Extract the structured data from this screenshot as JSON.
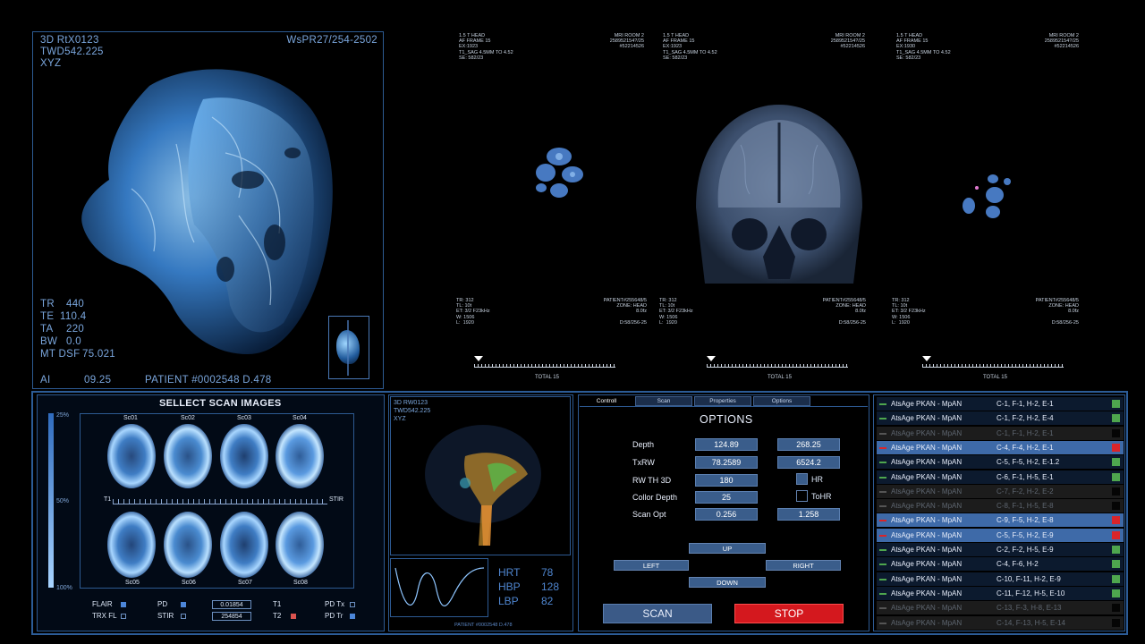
{
  "head_panel": {
    "id_line1": "3D RtX0123",
    "id_line2": "TWD542.225",
    "id_line3": "XYZ",
    "ref": "WsPR27/254-2502",
    "stats": [
      {
        "label": "TR",
        "value": "440"
      },
      {
        "label": "TE",
        "value": "110.4"
      },
      {
        "label": "TA",
        "value": "220"
      },
      {
        "label": "BW",
        "value": "0.0"
      },
      {
        "label": "MT DSF",
        "value": "75.021"
      }
    ],
    "ai_label": "AI",
    "ai_value": "09.25",
    "patient": "PATIENT #0002548 D.478"
  },
  "slices": [
    {
      "tl": "1.5 T HEAD\nAF FRAME 15\nEX:1923\nT1_SAG 4.5MM TO 4.52\nSE: 582/23",
      "tr": "MRI ROOM 2\n258952154?/25\n#52214526",
      "bl": "TR: 312\nTL: 10t\nET: 3/2 F23kHz\nW: 1506\nL:  1920",
      "br": "PATIENT#255648/5\nZONE: HEAD\n8.0fz\n\nD:58/256-25",
      "total": "TOTAL 15"
    },
    {
      "tl": "1.5 T HEAD\nAF FRAME 15\nEX:1923\nT1_SAG 4.5MM TO 4.52\nSE: 582/23",
      "tr": "MRI ROOM 2\n258952154?/25\n#52214526",
      "bl": "TR: 312\nTL: 10t\nET: 3/2 F23kHz\nW: 1506\nL:  1920",
      "br": "PATIENT#255648/5\nZONE: HEAD\n8.0fz\n\nD:58/256-25",
      "total": "TOTAL 15"
    },
    {
      "tl": "1.5 T HEAD\nAF FRAME 15\nEX:1930\nT1_SAG 4.5MM TO 4.52\nSE: 582/23",
      "tr": "MRI ROOM 2\n258952154?/25\n#52214526",
      "bl": "TR: 312\nTL: 10t\nET: 3/2 F23kHz\nW: 1506\nL:  1920",
      "br": "PATIENT#255648/5\nZONE: HEAD\n8.0fz\n\nD:58/256-25",
      "total": "TOTAL 15"
    }
  ],
  "scan_select": {
    "title": "SELLECT SCAN IMAGES",
    "scale_top": "25%",
    "scale_mid": "50%",
    "scale_bottom": "100%",
    "top_labels": [
      "Sc01",
      "Sc02",
      "Sc03",
      "Sc04"
    ],
    "bottom_labels": [
      "Sc05",
      "Sc06",
      "Sc07",
      "Sc08"
    ],
    "axis_left": "T1",
    "axis_right": "STIR",
    "legend": {
      "flair": "FLAIR",
      "trx": "TRX FL",
      "pd": "PD",
      "stir": "STIR",
      "val1": "0.01854",
      "val2": "254854",
      "t1": "T1",
      "t2": "T2",
      "pdtx": "PD Tx",
      "pdtr": "PD Tr"
    }
  },
  "mini3d": {
    "line1": "3D RW0123",
    "line2": "TWD542.225",
    "line3": "XYZ",
    "vitals": [
      {
        "label": "HRT",
        "value": "78"
      },
      {
        "label": "HBP",
        "value": "128"
      },
      {
        "label": "LBP",
        "value": "82"
      }
    ],
    "patient": "PATIENT #0002548 D.478"
  },
  "options": {
    "tabs": [
      "Controll",
      "Scan",
      "Properties",
      "Options"
    ],
    "title": "OPTIONS",
    "rows": [
      {
        "label": "Depth",
        "v1": "124.89",
        "v2": "268.25"
      },
      {
        "label": "TxRW",
        "v1": "78.2589",
        "v2": "6524.2"
      },
      {
        "label": "RW TH 3D",
        "v1": "180"
      },
      {
        "label": "Collor Depth",
        "v1": "25"
      },
      {
        "label": "Scan Opt",
        "v1": "0.256",
        "v2": "1.258"
      }
    ],
    "hr": "HR",
    "tohr": "ToHR",
    "up": "UP",
    "left": "LEFT",
    "right": "RIGHT",
    "down": "DOWN",
    "scan": "SCAN",
    "stop": "STOP"
  },
  "list": [
    {
      "name": "AtsAge PKAN - MpAN",
      "code": "C-1, F-1, H-2, E-1",
      "state": "ok",
      "dim": false,
      "hl": false
    },
    {
      "name": "AtsAge PKAN - MpAN",
      "code": "C-1, F-2, H-2, E-4",
      "state": "ok",
      "dim": false,
      "hl": false
    },
    {
      "name": "AtsAge PKAN - MpAN",
      "code": "C-1, F-1, H-2, E-1",
      "state": "off",
      "dim": true,
      "hl": false
    },
    {
      "name": "AtsAge PKAN - MpAN",
      "code": "C-4, F-4, H-2, E-1",
      "state": "err",
      "dim": false,
      "hl": true
    },
    {
      "name": "AtsAge PKAN - MpAN",
      "code": "C-5, F-5, H-2, E-1.2",
      "state": "ok",
      "dim": false,
      "hl": false
    },
    {
      "name": "AtsAge PKAN - MpAN",
      "code": "C-6, F-1, H-5, E-1",
      "state": "ok",
      "dim": false,
      "hl": false
    },
    {
      "name": "AtsAge PKAN - MpAN",
      "code": "C-7, F-2, H-2, E-2",
      "state": "off",
      "dim": true,
      "hl": false
    },
    {
      "name": "AtsAge PKAN - MpAN",
      "code": "C-8, F-1, H-5, E-8",
      "state": "off",
      "dim": true,
      "hl": false
    },
    {
      "name": "AtsAge PKAN - MpAN",
      "code": "C-9, F-5, H-2, E-8",
      "state": "err",
      "dim": false,
      "hl": true
    },
    {
      "name": "AtsAge PKAN - MpAN",
      "code": "C-5, F-5, H-2, E-9",
      "state": "err",
      "dim": false,
      "hl": true
    },
    {
      "name": "AtsAge PKAN - MpAN",
      "code": "C-2, F-2, H-5, E-9",
      "state": "ok",
      "dim": false,
      "hl": false
    },
    {
      "name": "AtsAge PKAN - MpAN",
      "code": "C-4, F-6, H-2",
      "state": "ok",
      "dim": false,
      "hl": false
    },
    {
      "name": "AtsAge PKAN - MpAN",
      "code": "C-10, F-11, H-2, E-9",
      "state": "ok",
      "dim": false,
      "hl": false
    },
    {
      "name": "AtsAge PKAN - MpAN",
      "code": "C-11, F-12, H-5, E-10",
      "state": "ok",
      "dim": false,
      "hl": false
    },
    {
      "name": "AtsAge PKAN - MpAN",
      "code": "C-13, F-3, H-8, E-13",
      "state": "off",
      "dim": true,
      "hl": false
    },
    {
      "name": "AtsAge PKAN - MpAN",
      "code": "C-14, F-13, H-5, E-14",
      "state": "off",
      "dim": true,
      "hl": false
    }
  ],
  "colors": {
    "accent": "#2d5a92",
    "ok": "#4ea64e",
    "error": "#d9252a",
    "highlight": "#3e6aa8",
    "stop": "#d4181e"
  }
}
